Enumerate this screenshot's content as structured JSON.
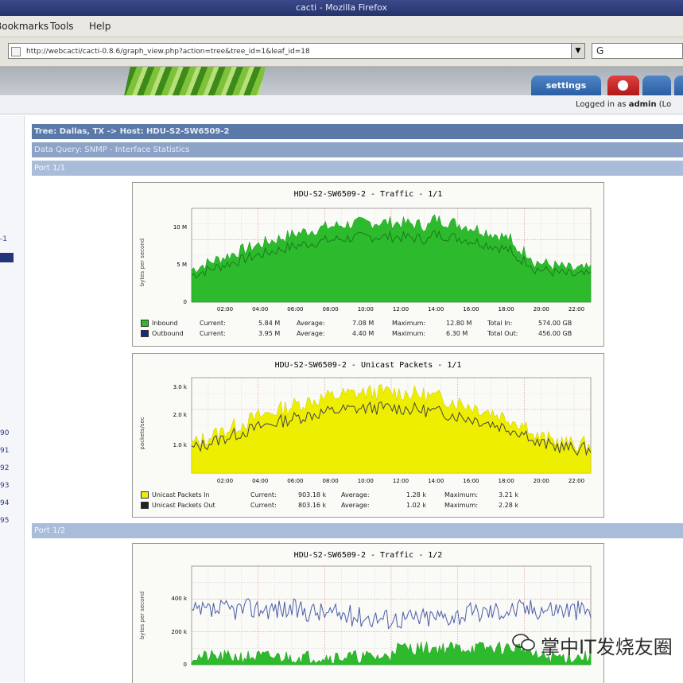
{
  "window": {
    "title": "cacti - Mozilla Firefox"
  },
  "menu": {
    "items": [
      "Bookmarks",
      "Tools",
      "Help"
    ]
  },
  "url": {
    "value": "http://webcacti/cacti-0.8.6/graph_view.php?action=tree&tree_id=1&leaf_id=18",
    "search_value": "G"
  },
  "tabs": {
    "settings": "settings"
  },
  "login": {
    "text": "Logged in as",
    "user": "admin",
    "logout": "(Lo"
  },
  "sidebar": {
    "fragments": [
      "-1",
      "90",
      "91",
      "92",
      "93",
      "94",
      "95"
    ]
  },
  "breadcrumbs": {
    "tree": "Tree: Dallas, TX -> Host: HDU-S2-SW6509-2",
    "data_query": "Data Query: SNMP - Interface Statistics",
    "port1": "Port 1/1",
    "port2": "Port 1/2"
  },
  "graphs": {
    "traffic_1": {
      "title": "HDU-S2-SW6509-2 - Traffic - 1/1",
      "ylabel": "bytes per second",
      "yticks": [
        "10 M",
        "5 M",
        "0"
      ],
      "xticks": [
        "02:00",
        "04:00",
        "06:00",
        "08:00",
        "10:00",
        "12:00",
        "14:00",
        "16:00",
        "18:00",
        "20:00",
        "22:00"
      ],
      "legend": [
        {
          "name": "Inbound",
          "color": "#2dbb2d",
          "current": "5.84 M",
          "average": "7.08 M",
          "maximum": "12.80 M",
          "total_label": "Total In:",
          "total": "574.00 GB"
        },
        {
          "name": "Outbound",
          "color": "#1a2a7a",
          "current": "3.95 M",
          "average": "4.40 M",
          "maximum": "6.30 M",
          "total_label": "Total Out:",
          "total": "456.00 GB"
        }
      ],
      "labels": {
        "current": "Current:",
        "average": "Average:",
        "maximum": "Maximum:"
      }
    },
    "unicast_1": {
      "title": "HDU-S2-SW6509-2 - Unicast Packets - 1/1",
      "ylabel": "packets/sec",
      "yticks": [
        "3.0 k",
        "2.0 k",
        "1.0 k"
      ],
      "xticks": [
        "02:00",
        "04:00",
        "06:00",
        "08:00",
        "10:00",
        "12:00",
        "14:00",
        "16:00",
        "18:00",
        "20:00",
        "22:00"
      ],
      "legend": [
        {
          "name": "Unicast Packets In",
          "color": "#eeee00",
          "current": "903.18 k",
          "average": "1.28 k",
          "maximum": "3.21 k"
        },
        {
          "name": "Unicast Packets Out",
          "color": "#222222",
          "current": "803.16 k",
          "average": "1.02 k",
          "maximum": "2.28 k"
        }
      ],
      "labels": {
        "current": "Current:",
        "average": "Average:",
        "maximum": "Maximum:"
      }
    },
    "traffic_2": {
      "title": "HDU-S2-SW6509-2 - Traffic - 1/2",
      "ylabel": "bytes per second",
      "yticks": [
        "400 k",
        "200 k",
        "0"
      ]
    }
  },
  "watermark": {
    "text": "掌中IT发烧友圈"
  }
}
